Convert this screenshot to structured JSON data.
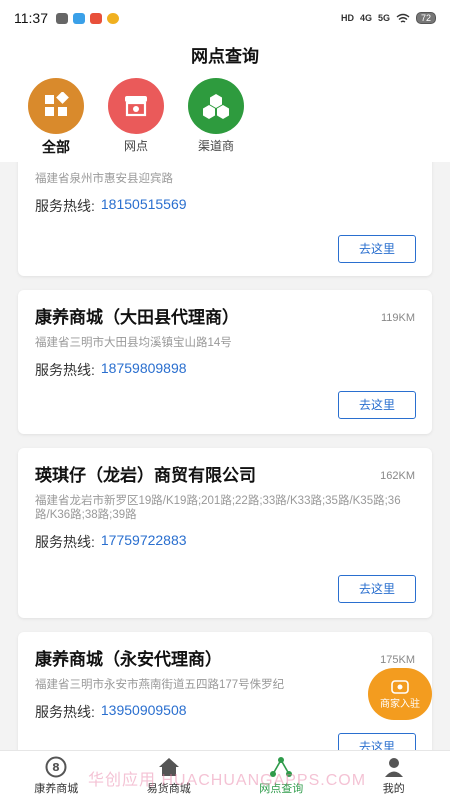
{
  "status": {
    "time": "11:37",
    "sig1": "HD",
    "sig2": "4G",
    "sig3": "5G",
    "battery": "72"
  },
  "header": {
    "title": "网点查询"
  },
  "filters": [
    {
      "label": "全部",
      "icon": "grid-icon",
      "color": "#d98a2c"
    },
    {
      "label": "网点",
      "icon": "shop-icon",
      "color": "#ea5a5a"
    },
    {
      "label": "渠道商",
      "icon": "hexagon-cluster-icon",
      "color": "#2e9b3e"
    }
  ],
  "cards": [
    {
      "title": "",
      "distance": "",
      "address": "福建省泉州市惠安县迎宾路",
      "phone_label": "服务热线:",
      "phone": "18150515569",
      "button": "去这里"
    },
    {
      "title": "康养商城（大田县代理商）",
      "distance": "119KM",
      "address": "福建省三明市大田县均溪镇宝山路14号",
      "phone_label": "服务热线:",
      "phone": "18759809898",
      "button": "去这里"
    },
    {
      "title": "瑛琪仔（龙岩）商贸有限公司",
      "distance": "162KM",
      "address": "福建省龙岩市新罗区19路/K19路;201路;22路;33路/K33路;35路/K35路;36路/K36路;38路;39路",
      "phone_label": "服务热线:",
      "phone": "17759722883",
      "button": "去这里"
    },
    {
      "title": "康养商城（永安代理商）",
      "distance": "175KM",
      "address": "福建省三明市永安市燕南街道五四路177号侏罗纪",
      "phone_label": "服务热线:",
      "phone": "13950909508",
      "button": "去这里"
    }
  ],
  "fab": {
    "label": "商家入驻",
    "icon": "store-icon"
  },
  "tabs": [
    {
      "label": "康养商城",
      "icon": "home-logo-icon"
    },
    {
      "label": "易货商城",
      "icon": "house-icon"
    },
    {
      "label": "网点查询",
      "icon": "network-icon"
    },
    {
      "label": "我的",
      "icon": "user-icon"
    }
  ],
  "watermark": "华创应用 HUACHUANGAPPS.COM"
}
